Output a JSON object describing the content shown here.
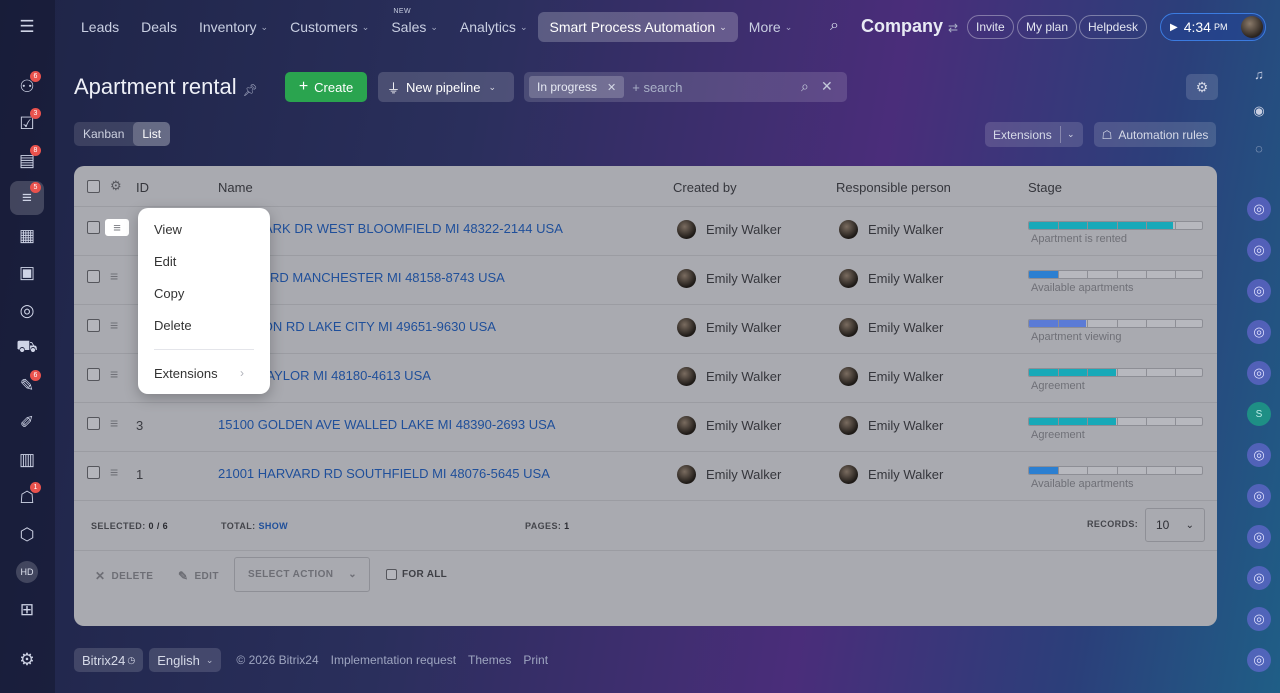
{
  "nav": {
    "items": [
      {
        "label": "Leads",
        "dropdown": false,
        "active": false,
        "tag": ""
      },
      {
        "label": "Deals",
        "dropdown": false,
        "active": false,
        "tag": ""
      },
      {
        "label": "Inventory",
        "dropdown": true,
        "active": false,
        "tag": ""
      },
      {
        "label": "Customers",
        "dropdown": true,
        "active": false,
        "tag": ""
      },
      {
        "label": "Sales",
        "dropdown": true,
        "active": false,
        "tag": "NEW"
      },
      {
        "label": "Analytics",
        "dropdown": true,
        "active": false,
        "tag": ""
      },
      {
        "label": "Smart Process Automation",
        "dropdown": true,
        "active": true,
        "tag": ""
      },
      {
        "label": "More",
        "dropdown": true,
        "active": false,
        "tag": ""
      }
    ],
    "company": "Company",
    "invite": "Invite",
    "my_plan": "My plan",
    "helpdesk": "Helpdesk",
    "time": "4:34",
    "ampm": "PM"
  },
  "sidebar": {
    "badges": [
      "6",
      "3",
      "8",
      "5",
      "6",
      "1"
    ],
    "hd": "HD"
  },
  "rightbar": {
    "s_label": "S"
  },
  "header": {
    "title": "Apartment rental",
    "create": "Create",
    "new_pipeline": "New pipeline",
    "filter_chip": "In progress",
    "search_placeholder": "+ search"
  },
  "views": {
    "kanban": "Kanban",
    "list": "List",
    "extensions": "Extensions",
    "automation_rules": "Automation rules"
  },
  "grid": {
    "columns": {
      "id": "ID",
      "name": "Name",
      "created_by": "Created by",
      "responsible": "Responsible person",
      "stage": "Stage"
    },
    "rows": [
      {
        "id": "",
        "name": "LAGE PARK DR WEST BLOOMFIELD MI 48322-2144 USA",
        "created_by": "Emily Walker",
        "responsible": "Emily Walker",
        "stage": "Apartment is rented",
        "progress": 0.83,
        "color": "#19a9b9"
      },
      {
        "id": "",
        "name": "NGLISH RD MANCHESTER MI 48158-8743 USA",
        "created_by": "Emily Walker",
        "responsible": "Emily Walker",
        "stage": "Available apartments",
        "progress": 0.17,
        "color": "#2b7fd1"
      },
      {
        "id": "",
        "name": "UTCHEON RD LAKE CITY MI 49651-9630 USA",
        "created_by": "Emily Walker",
        "responsible": "Emily Walker",
        "stage": "Apartment viewing",
        "progress": 0.33,
        "color": "#5b7bd6"
      },
      {
        "id": "",
        "name": "NE ST TAYLOR MI 48180-4613 USA",
        "created_by": "Emily Walker",
        "responsible": "Emily Walker",
        "stage": "Agreement",
        "progress": 0.5,
        "color": "#17a9b8"
      },
      {
        "id": "3",
        "name": "15100 GOLDEN AVE WALLED LAKE MI 48390-2693 USA",
        "created_by": "Emily Walker",
        "responsible": "Emily Walker",
        "stage": "Agreement",
        "progress": 0.5,
        "color": "#17a9b8"
      },
      {
        "id": "1",
        "name": "21001 HARVARD RD SOUTHFIELD MI 48076-5645 USA",
        "created_by": "Emily Walker",
        "responsible": "Emily Walker",
        "stage": "Available apartments",
        "progress": 0.17,
        "color": "#2b7fd1"
      }
    ],
    "footer": {
      "selected_label": "SELECTED:",
      "selected_value": "0 / 6",
      "total_label": "TOTAL:",
      "total_link": "SHOW",
      "pages_label": "PAGES:",
      "pages_value": "1",
      "records_label": "RECORDS:",
      "records_value": "10"
    },
    "actions": {
      "delete": "DELETE",
      "edit": "EDIT",
      "select_action": "SELECT ACTION",
      "for_all": "FOR ALL"
    }
  },
  "context_menu": {
    "view": "View",
    "edit": "Edit",
    "copy": "Copy",
    "delete": "Delete",
    "extensions": "Extensions"
  },
  "footer": {
    "brand": "Bitrix24",
    "language": "English",
    "copyright": "© 2026 Bitrix24",
    "implementation": "Implementation request",
    "themes": "Themes",
    "print": "Print"
  }
}
